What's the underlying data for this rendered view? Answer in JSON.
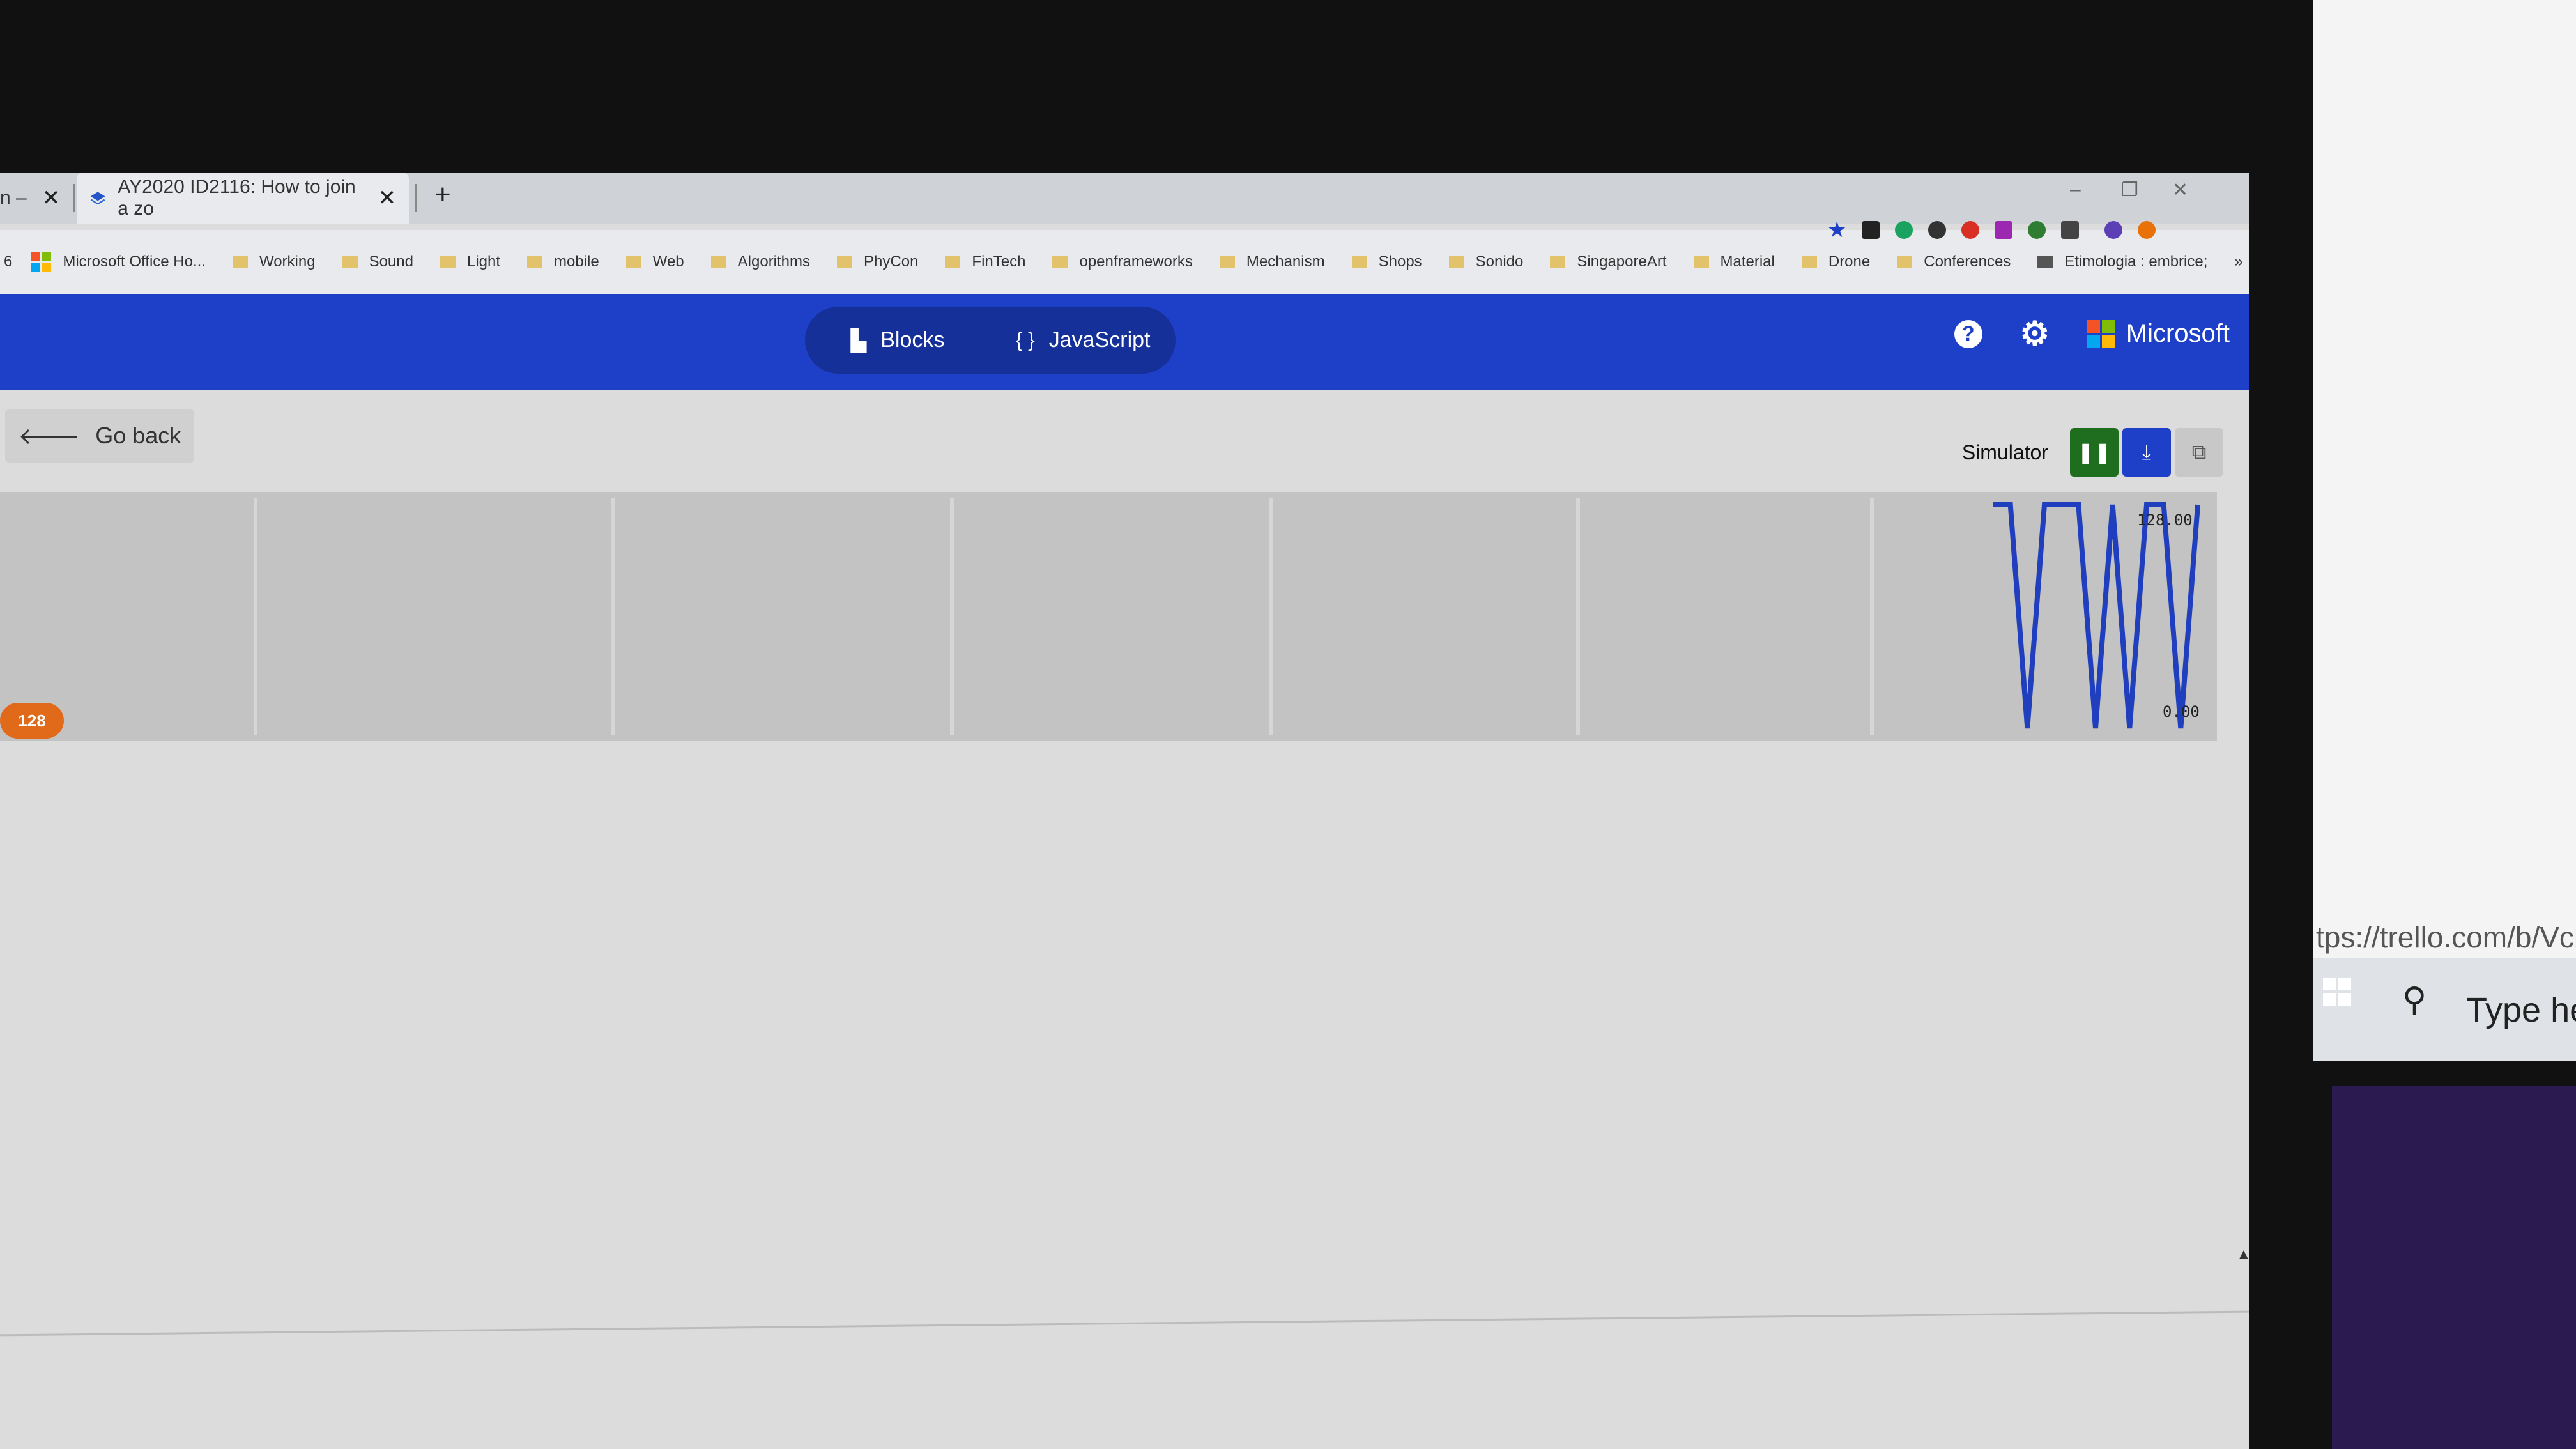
{
  "browser": {
    "tabs": [
      {
        "label": "n –",
        "close": "✕"
      },
      {
        "label": "AY2020 ID2116: How to join a zo",
        "close": "✕"
      }
    ],
    "new_tab": "+",
    "window_controls": [
      "–",
      "❐",
      "✕"
    ],
    "bookmark_prefix": "6",
    "bookmarks": [
      "Microsoft Office Ho...",
      "Working",
      "Sound",
      "Light",
      "mobile",
      "Web",
      "Algorithms",
      "PhyCon",
      "FinTech",
      "openframeworks",
      "Mechanism",
      "Shops",
      "Sonido",
      "SingaporeArt",
      "Material",
      "Drone",
      "Conferences",
      "Etimologia : embrice;"
    ],
    "more": "»"
  },
  "header": {
    "blocks_label": "Blocks",
    "javascript_label": "JavaScript",
    "brand": "Microsoft",
    "help": "?",
    "settings": "⚙"
  },
  "toolbar": {
    "go_back": "Go back",
    "simulator": "Simulator"
  },
  "chart_data": {
    "type": "line",
    "ylim": [
      0,
      128
    ],
    "ymax_label": "128.00",
    "ymin_label": "0.00",
    "badge": "128",
    "series": [
      {
        "color": "#1f3fbf",
        "values": [
          128,
          128,
          0,
          128,
          128,
          128,
          0,
          128,
          0,
          128,
          128,
          0,
          128
        ]
      }
    ],
    "grid": true
  },
  "colors": {
    "header_blue": "#1e40c8",
    "pause_green": "#1f6e1f",
    "download_blue": "#1e40c8",
    "badge_orange": "#e06a1a"
  },
  "desktop": {
    "trello_url": "tps://trello.com/b/Vcb",
    "search_placeholder": "Type he"
  }
}
